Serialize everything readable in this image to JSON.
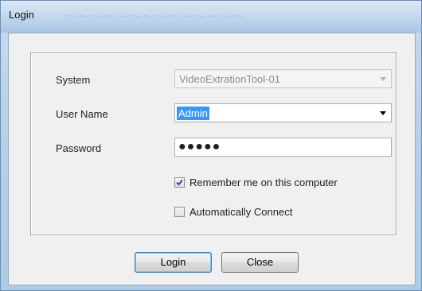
{
  "window": {
    "title": "Login"
  },
  "form": {
    "system": {
      "label": "System",
      "value": "VideoExtrationTool-01",
      "enabled": false
    },
    "username": {
      "label": "User Name",
      "value": "Admin"
    },
    "password": {
      "label": "Password",
      "masked_value": "●●●●●"
    },
    "remember": {
      "label": "Remember me on this computer",
      "checked": true
    },
    "auto_connect": {
      "label": "Automatically Connect",
      "checked": false
    }
  },
  "buttons": {
    "login": "Login",
    "close": "Close"
  },
  "icons": {
    "dropdown": "chevron-down-icon",
    "check": "checkmark-icon"
  },
  "colors": {
    "selection": "#3399ff",
    "titlebar": "#c3d7ec",
    "client": "#f0f0f0"
  }
}
